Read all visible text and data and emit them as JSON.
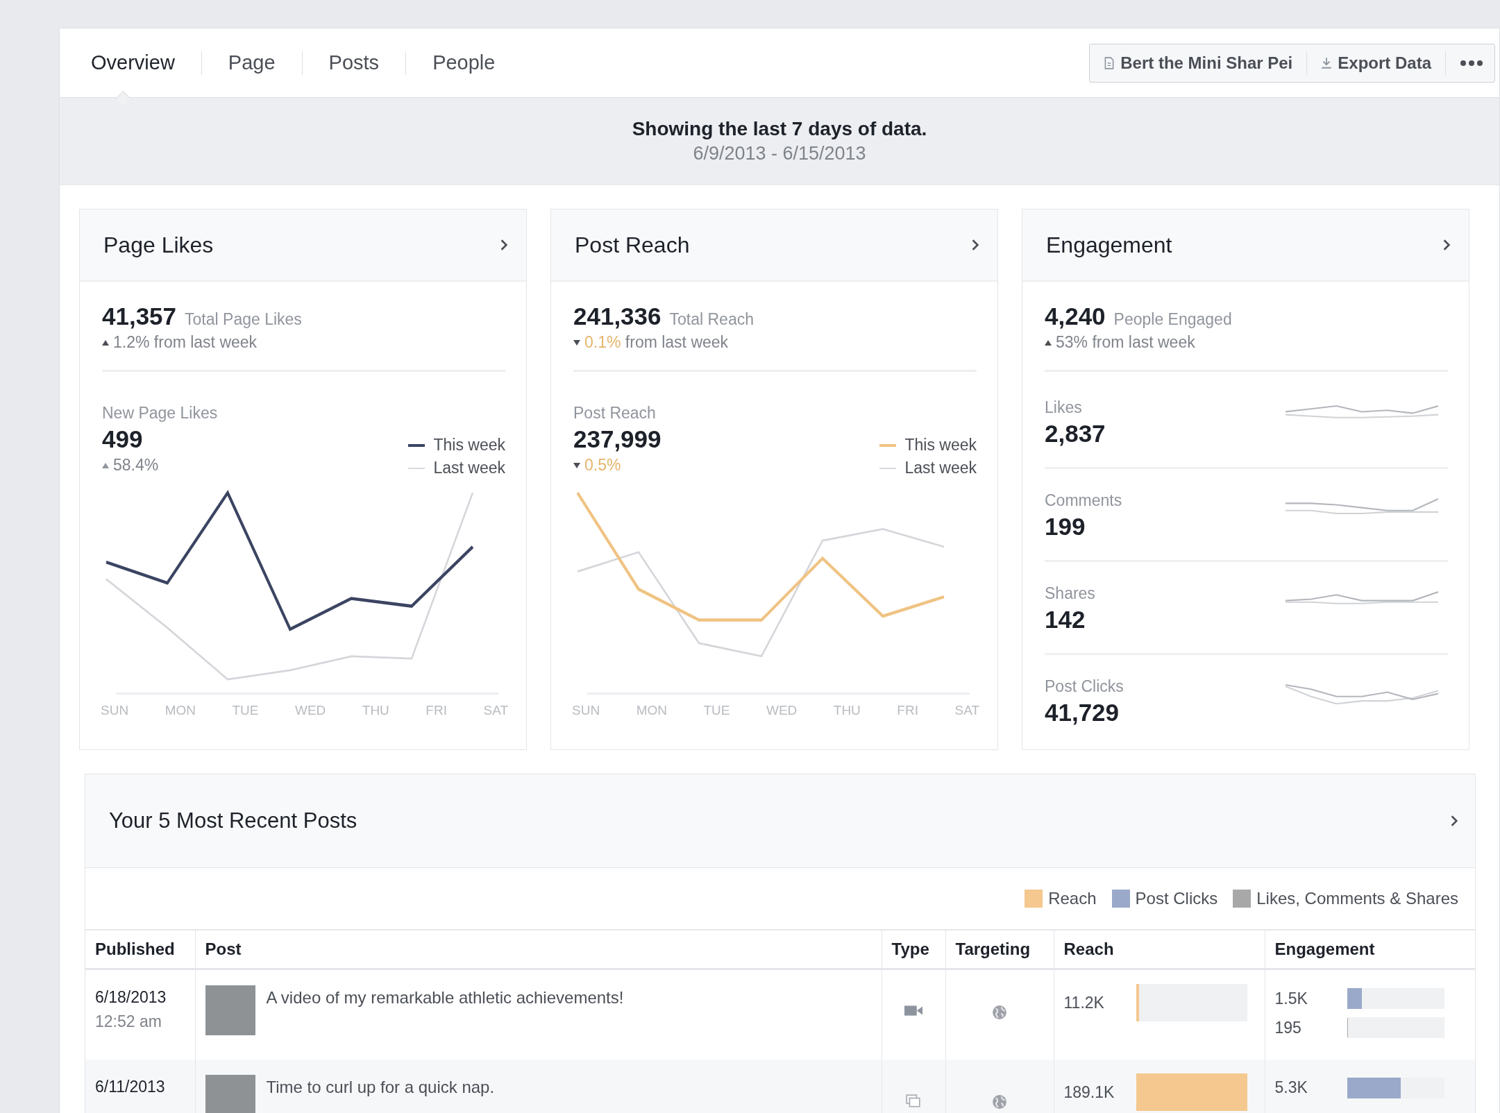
{
  "tabs": [
    {
      "label": "Overview",
      "selected": true
    },
    {
      "label": "Page",
      "selected": false
    },
    {
      "label": "Posts",
      "selected": false
    },
    {
      "label": "People",
      "selected": false
    }
  ],
  "actions": [
    {
      "kind": "page",
      "label": "Bert the Mini Shar Pei"
    },
    {
      "kind": "export",
      "label": "Export Data"
    },
    {
      "kind": "more"
    }
  ],
  "banner": {
    "title": "Showing the last 7 days of data.",
    "range": "6/9/2013 - 6/15/2013"
  },
  "cards": [
    {
      "kind": "chart",
      "title": "Page Likes",
      "total": "41,357",
      "total_label": "Total Page Likes",
      "change": {
        "rising": true,
        "value": "1.2%",
        "text": "from last week"
      },
      "metric": {
        "label": "New Page Likes",
        "value": "499",
        "change": {
          "rising": true,
          "value": "58.4%"
        }
      },
      "color": "#3b4461",
      "legend": [
        "This week",
        "Last week"
      ],
      "days": [
        "SUN",
        "MON",
        "TUE",
        "WED",
        "THU",
        "FRI",
        "SAT"
      ]
    },
    {
      "kind": "chart",
      "title": "Post Reach",
      "total": "241,336",
      "total_label": "Total Reach",
      "change": {
        "rising": false,
        "value": "0.1%",
        "text": "from last week"
      },
      "metric": {
        "label": "Post Reach",
        "value": "237,999",
        "change": {
          "rising": false,
          "value": "0.5%"
        }
      },
      "color": "#f0c383",
      "legend": [
        "This week",
        "Last week"
      ],
      "days": [
        "SUN",
        "MON",
        "TUE",
        "WED",
        "THU",
        "FRI",
        "SAT"
      ]
    },
    {
      "kind": "breakdown",
      "title": "Engagement",
      "total": "4,240",
      "total_label": "People Engaged",
      "change": {
        "rising": true,
        "value": "53%",
        "text": "from last week"
      },
      "rows": [
        {
          "label": "Likes",
          "value": "2,837"
        },
        {
          "label": "Comments",
          "value": "199"
        },
        {
          "label": "Shares",
          "value": "142"
        },
        {
          "label": "Post Clicks",
          "value": "41,729"
        }
      ]
    }
  ],
  "recent": {
    "title": "Your 5 Most Recent Posts",
    "legend": [
      {
        "label": "Reach",
        "color": "#f5c88f"
      },
      {
        "label": "Post Clicks",
        "color": "#9aa9c9"
      },
      {
        "label": "Likes, Comments & Shares",
        "color": "#a8a8a8"
      }
    ],
    "columns": [
      "Published",
      "Post",
      "Type",
      "Targeting",
      "Reach",
      "Engagement"
    ],
    "rows": [
      {
        "date": "6/18/2013",
        "time": "12:52 am",
        "post": "A video of my remarkable athletic achievements!",
        "kind": "video",
        "reach": {
          "value": "11.2K",
          "level": 0.03
        },
        "engagement": [
          {
            "kind": "clicks",
            "value": "1.5K",
            "level": 0.15
          },
          {
            "kind": "lcs",
            "value": "195",
            "level": 0.01
          }
        ]
      },
      {
        "date": "6/11/2013",
        "post": "Time to curl up for a quick nap.",
        "kind": "photo",
        "reach": {
          "value": "189.1K",
          "level": 1
        },
        "engagement": [
          {
            "kind": "clicks",
            "value": "5.3K",
            "level": 0.55
          }
        ]
      }
    ]
  }
}
